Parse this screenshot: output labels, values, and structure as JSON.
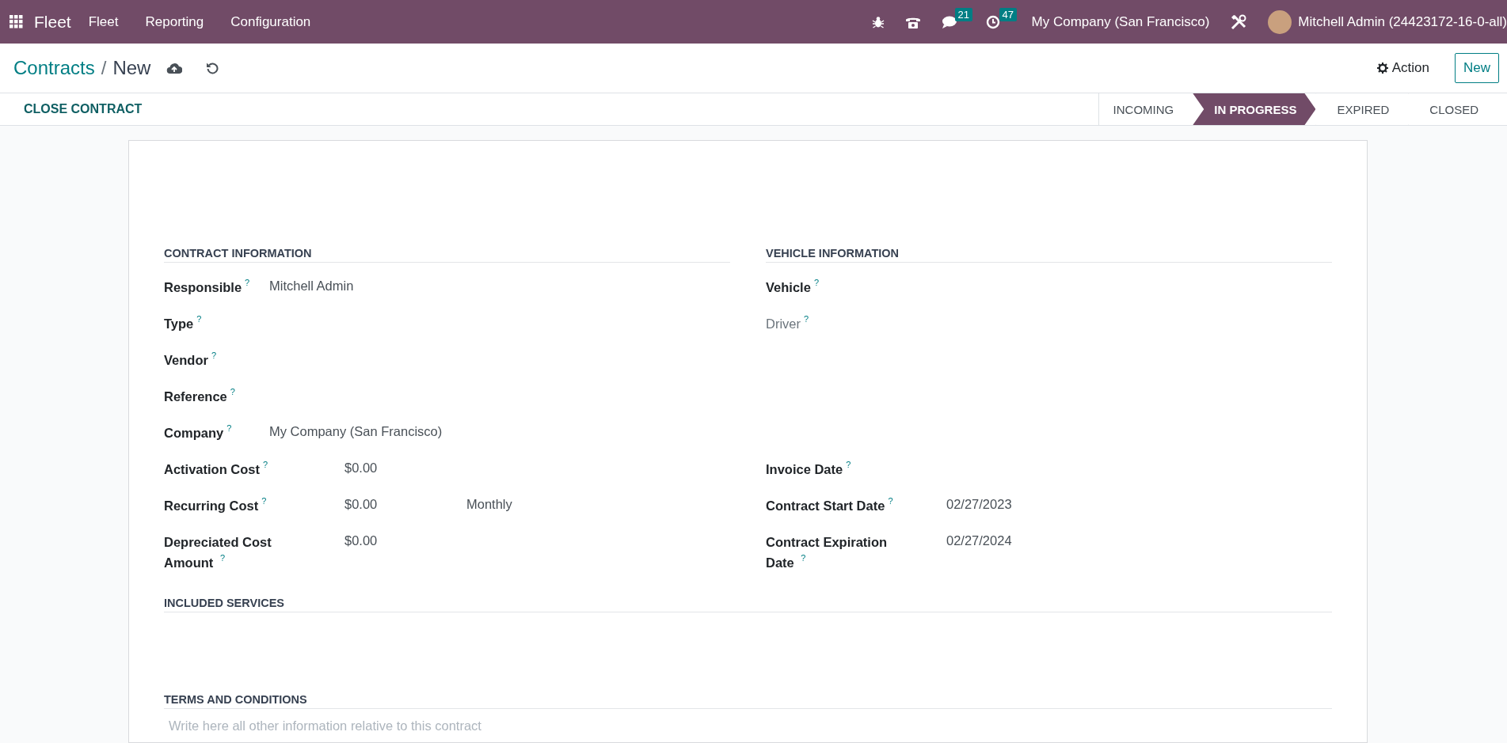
{
  "navbar": {
    "app_name": "Fleet",
    "menus": [
      "Fleet",
      "Reporting",
      "Configuration"
    ],
    "messages_badge": "21",
    "activities_badge": "47",
    "company": "My Company (San Francisco)",
    "user": "Mitchell Admin (24423172-16-0-all)"
  },
  "breadcrumbs": [
    "Contracts",
    "New"
  ],
  "breadcrumb_separator": "/",
  "actions": {
    "action_menu": "Action",
    "new_button": "New"
  },
  "status_bar": {
    "buttons": [
      "CLOSE CONTRACT"
    ],
    "stages": [
      {
        "label": "INCOMING",
        "selected": false
      },
      {
        "label": "IN PROGRESS",
        "selected": true
      },
      {
        "label": "EXPIRED",
        "selected": false
      },
      {
        "label": "CLOSED",
        "selected": false
      }
    ]
  },
  "contract_information": {
    "title": "CONTRACT INFORMATION",
    "fields": [
      {
        "label": "Responsible",
        "help": "?",
        "value": "Mitchell Admin"
      },
      {
        "label": "Type",
        "help": "?"
      },
      {
        "label": "Vendor",
        "help": "?"
      },
      {
        "label": "Reference",
        "help": "?"
      },
      {
        "label": "Company",
        "help": "?",
        "value": "My Company (San Francisco)"
      }
    ]
  },
  "vehicle_information": {
    "title": "VEHICLE INFORMATION",
    "fields": [
      {
        "label": "Vehicle",
        "help": "?",
        "readonly": false
      },
      {
        "label": "Driver",
        "help": "?",
        "readonly": true
      }
    ]
  },
  "cost_fields": [
    {
      "label": "Activation Cost",
      "help": "?",
      "value": "$0.00"
    },
    {
      "label": "Recurring Cost",
      "help": "?",
      "value": "$0.00",
      "period": "Monthly"
    },
    {
      "label": "Depreciated Cost Amount $^{?}$",
      "value": "$0.00"
    }
  ],
  "date_fields": [
    {
      "label": "Invoice Date",
      "help": "?"
    },
    {
      "label": "Contract Start Date",
      "help": "?",
      "value": "02/27/2023"
    },
    {
      "label": "Contract Expiration Date $^{?}$",
      "value": "02/27/2024"
    }
  ],
  "included_services": {
    "title": "INCLUDED SERVICES"
  },
  "terms_and_conditions": {
    "title": "TERMS AND CONDITIONS",
    "placeholder": "Write here all other information relative to this contract"
  }
}
